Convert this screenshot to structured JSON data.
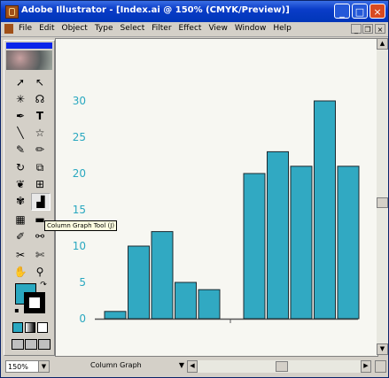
{
  "window": {
    "title": "Adobe Illustrator - [Index.ai @ 150% (CMYK/Preview)]"
  },
  "title_buttons": {
    "minimize": "_",
    "maximize": "□",
    "close": "×"
  },
  "menu": {
    "items": [
      "File",
      "Edit",
      "Object",
      "Type",
      "Select",
      "Filter",
      "Effect",
      "View",
      "Window",
      "Help"
    ]
  },
  "doc_controls": {
    "minimize": "_",
    "restore": "❐",
    "close": "×"
  },
  "tooltip": "Column Graph Tool (J)",
  "status": {
    "zoom": "150%",
    "tool_name": "Column Graph"
  },
  "colors": {
    "fill": "#2aa8c0",
    "bars": "#31a9c2",
    "axis_text": "#2aa8c0"
  },
  "chart_data": {
    "type": "bar",
    "ylim": [
      0,
      30
    ],
    "yticks": [
      "0",
      "5",
      "10",
      "15",
      "20",
      "25",
      "30"
    ],
    "groups": [
      {
        "values": [
          1,
          10,
          12,
          5,
          4
        ]
      },
      {
        "values": [
          20,
          23,
          21,
          30,
          21
        ]
      }
    ]
  }
}
